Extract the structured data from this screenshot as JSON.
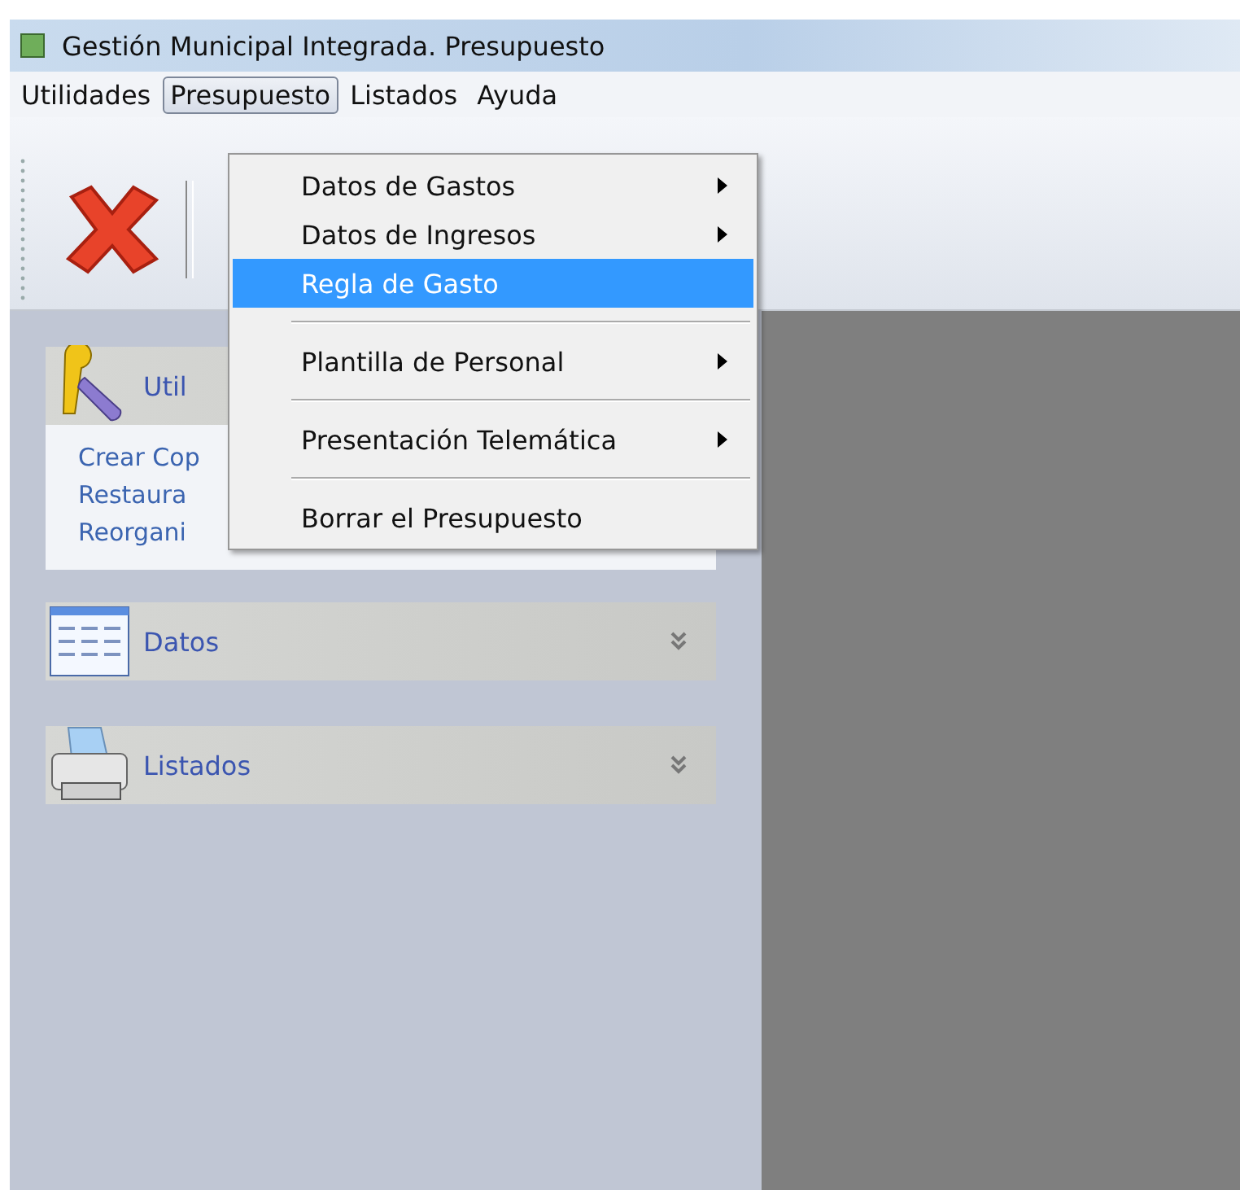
{
  "window": {
    "title": "Gestión Municipal Integrada. Presupuesto"
  },
  "menubar": [
    {
      "label": "Utilidades",
      "selected": false
    },
    {
      "label": "Presupuesto",
      "selected": true
    },
    {
      "label": "Listados",
      "selected": false
    },
    {
      "label": "Ayuda",
      "selected": false
    }
  ],
  "menu": [
    {
      "kind": "item",
      "label": "Datos de Gastos",
      "selected": false,
      "submenu": true
    },
    {
      "kind": "item",
      "label": "Datos de Ingresos",
      "selected": false,
      "submenu": true
    },
    {
      "kind": "item",
      "label": "Regla de Gasto",
      "selected": true,
      "submenu": false
    },
    {
      "kind": "separator"
    },
    {
      "kind": "item",
      "label": "Plantilla de Personal",
      "selected": false,
      "submenu": true
    },
    {
      "kind": "separator"
    },
    {
      "kind": "item",
      "label": "Presentación Telemática",
      "selected": false,
      "submenu": true
    },
    {
      "kind": "separator"
    },
    {
      "kind": "item",
      "label": "Borrar el Presupuesto",
      "selected": false,
      "submenu": false
    }
  ],
  "sidebar": {
    "groups": [
      {
        "kind": "tools",
        "title": "Util",
        "expanded": true,
        "links": [
          "Crear Cop",
          "Restaura",
          "Reorgani"
        ]
      },
      {
        "kind": "table",
        "title": "Datos",
        "expanded": false
      },
      {
        "kind": "printer",
        "title": "Listados",
        "expanded": false
      }
    ]
  }
}
